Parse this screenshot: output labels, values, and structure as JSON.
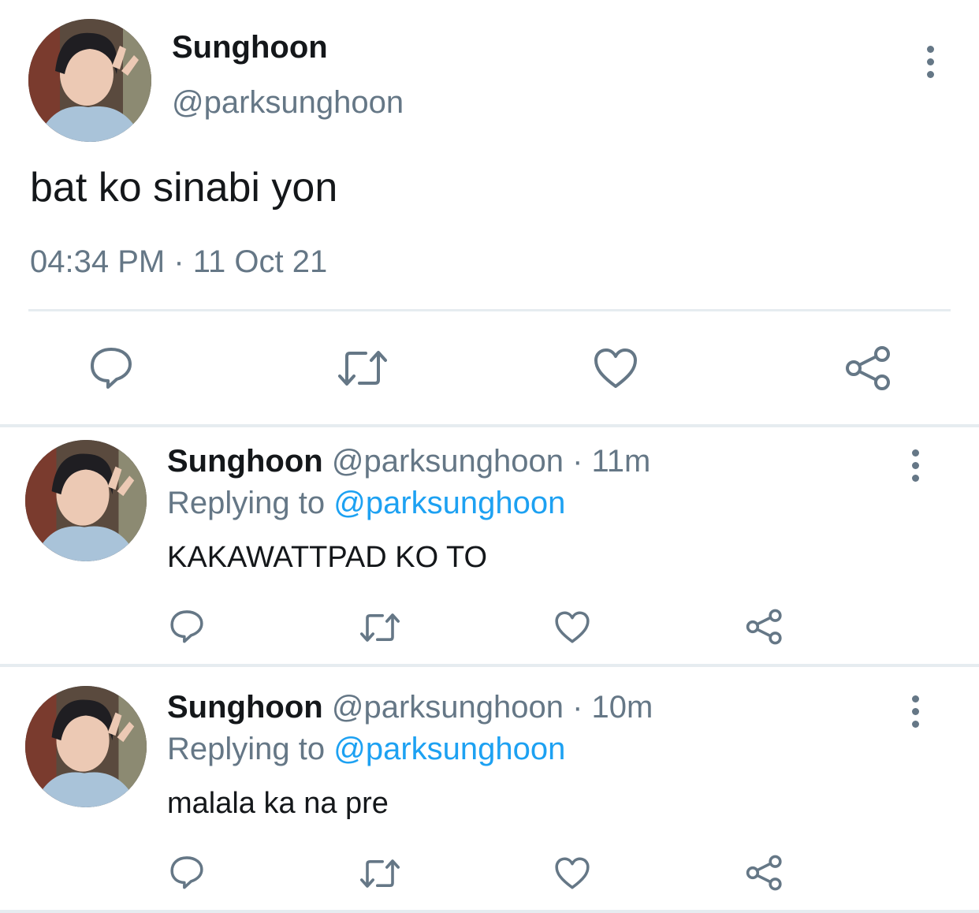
{
  "main_tweet": {
    "display_name": "Sunghoon",
    "handle": "@parksunghoon",
    "text": "bat ko sinabi yon",
    "timestamp": "04:34 PM · 11 Oct 21"
  },
  "actions": [
    "reply-icon",
    "retweet-icon",
    "like-icon",
    "share-icon"
  ],
  "replies": [
    {
      "display_name": "Sunghoon",
      "handle": "@parksunghoon",
      "time_sep": " · ",
      "time": "11m",
      "replying_label": "Replying to ",
      "replying_handle": "@parksunghoon",
      "text": "KAKAWATTPAD KO TO"
    },
    {
      "display_name": "Sunghoon",
      "handle": "@parksunghoon",
      "time_sep": " · ",
      "time": "10m",
      "replying_label": "Replying to ",
      "replying_handle": "@parksunghoon",
      "text": "malala ka na pre"
    }
  ],
  "colors": {
    "text": "#14171a",
    "secondary": "#657786",
    "link": "#1da1f2",
    "divider": "#e6ecf0"
  }
}
